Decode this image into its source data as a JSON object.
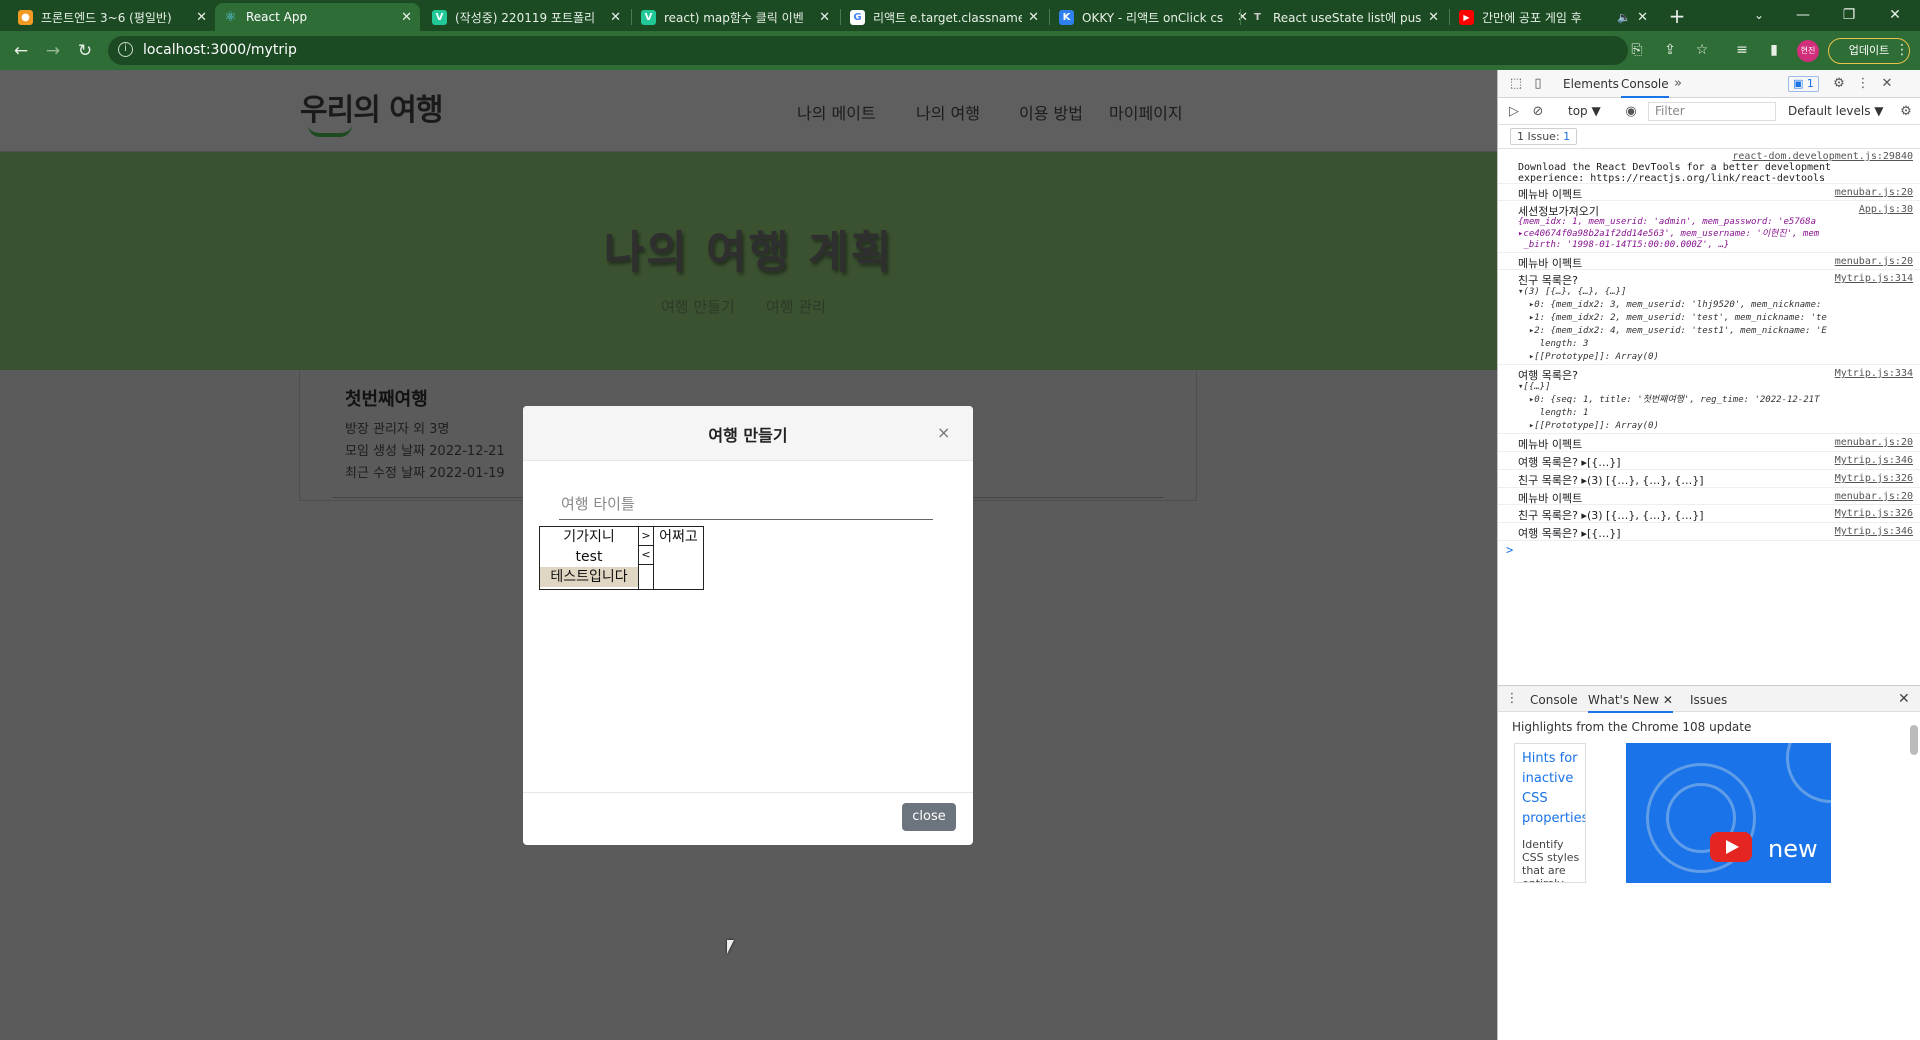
{
  "browser": {
    "tabs": [
      {
        "label": "프론트엔드 3~6 (평일반)",
        "favicon": "orange-fox-icon",
        "color": "#f29b24"
      },
      {
        "label": "React App",
        "favicon": "react-atom-icon",
        "color": "#61dafb"
      },
      {
        "label": "(작성중) 220119 포트폴리",
        "favicon": "velog-v-icon",
        "color": "#20c997"
      },
      {
        "label": "react) map함수 클릭 이벤",
        "favicon": "velog-v-icon",
        "color": "#20c997"
      },
      {
        "label": "리액트 e.target.classname",
        "favicon": "google-g-icon",
        "color": "#4285f4"
      },
      {
        "label": "OKKY - 리액트 onClick cs",
        "favicon": "okky-icon",
        "color": "#2f80ed"
      },
      {
        "label": "React useState list에 push",
        "favicon": "tistory-icon",
        "color": "#444444"
      },
      {
        "label": "간만에 공포 게임 후",
        "favicon": "youtube-icon",
        "color": "#ff0000"
      }
    ],
    "url": "localhost:3000/mytrip",
    "profile_label": "현진",
    "update_label": "업데이트"
  },
  "site": {
    "logo": "우리의 여행",
    "nav": [
      "나의 메이트",
      "나의 여행",
      "이용 방법",
      "마이페이지"
    ],
    "hero_title": "나의 여행 계획",
    "hero_links": [
      "여행 만들기",
      "여행 관리"
    ],
    "card": {
      "title": "첫번째여행",
      "lines": [
        "방장 관리자 외 3명",
        "모임 생성 날짜 2022-12-21",
        "최근 수정 날짜 2022-01-19"
      ]
    }
  },
  "modal": {
    "title": "여행 만들기",
    "close_x": "×",
    "title_placeholder": "여행 타이틀",
    "left_options": [
      "기가지니",
      "test",
      "테스트입니다"
    ],
    "selected_index": 2,
    "move_right": ">",
    "move_left": "<",
    "right_options": [
      "어쩌고"
    ],
    "close_label": "close"
  },
  "devtools": {
    "tabs": [
      "Elements",
      "Console"
    ],
    "badge": "1",
    "context": "top ▼",
    "filter_placeholder": "Filter",
    "levels": "Default levels ▼",
    "issue_label": "1 Issue:",
    "issue_count": "1",
    "console": [
      {
        "src": "react-dom.development.js:29840",
        "text": "Download the React DevTools for a better development\nexperience: https://reactjs.org/link/react-devtools"
      },
      {
        "src": "menubar.js:20",
        "text": "메뉴바 이펙트"
      },
      {
        "src": "App.js:30",
        "text": "세션정보가져오기",
        "obj": "{mem_idx: 1, mem_userid: 'admin', mem_password: 'e5768a\n▸ce40674f0a98b2a1f2dd14e563', mem_username: '이현진', mem\n _birth: '1998-01-14T15:00:00.000Z', …}"
      },
      {
        "src": "menubar.js:20",
        "text": "메뉴바 이펙트"
      },
      {
        "src": "Mytrip.js:314",
        "text": "친구 목록은?",
        "obj": "▾(3) [{…}, {…}, {…}]\n  ▸0: {mem_idx2: 3, mem_userid: 'lhj9520', mem_nickname:\n  ▸1: {mem_idx2: 2, mem_userid: 'test', mem_nickname: 'te\n  ▸2: {mem_idx2: 4, mem_userid: 'test1', mem_nickname: 'E\n    length: 3\n  ▸[[Prototype]]: Array(0)"
      },
      {
        "src": "Mytrip.js:334",
        "text": "여행 목록은?",
        "obj": "▾[{…}]\n  ▸0: {seq: 1, title: '첫번째여행', reg_time: '2022-12-21T\n    length: 1\n  ▸[[Prototype]]: Array(0)"
      },
      {
        "src": "menubar.js:20",
        "text": "메뉴바 이펙트"
      },
      {
        "src": "Mytrip.js:346",
        "text": "여행 목록은? ▸[{…}]"
      },
      {
        "src": "Mytrip.js:326",
        "text": "친구 목록은? ▸(3) [{…}, {…}, {…}]"
      },
      {
        "src": "menubar.js:20",
        "text": "메뉴바 이펙트"
      },
      {
        "src": "Mytrip.js:326",
        "text": "친구 목록은? ▸(3) [{…}, {…}, {…}]"
      },
      {
        "src": "Mytrip.js:346",
        "text": "여행 목록은? ▸[{…}]"
      }
    ],
    "prompt": ">",
    "drawer_tabs": [
      "Console",
      "What's New",
      "Issues"
    ],
    "whatsnew_heading": "Highlights from the Chrome 108 update",
    "card_title": "Hints for inactive CSS properties",
    "card_body": "Identify CSS styles that are entirely",
    "video_text": "new"
  }
}
